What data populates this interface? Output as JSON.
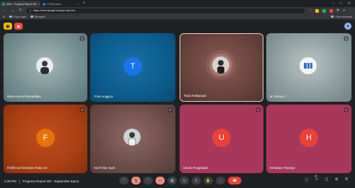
{
  "browser": {
    "tabs": [
      {
        "label": "Meet - Progress Report W2",
        "favicon_color": "#00ac47",
        "active": true
      },
      {
        "label": "IT DIR pame",
        "favicon_color": "#1a73e8",
        "active": false
      }
    ],
    "address": "https://meet.google.com/yjn-xrfp-hwo",
    "bookmarks": [
      {
        "label": "Pojok Ingin"
      },
      {
        "label": "Bimagam"
      }
    ],
    "other_bookmarks": "Other favorites"
  },
  "meet": {
    "participants": [
      {
        "name": "Reka Arminul Ramadhani",
        "type": "photo",
        "muted": true
      },
      {
        "name": "Trimo Anggoro",
        "type": "initial",
        "initial": "T",
        "avatar_color": "#1a73e8",
        "muted": false
      },
      {
        "name": "Firda Fathiaasari",
        "type": "photo",
        "muted": false,
        "speaking": true
      },
      {
        "name": "M. Wirnas A",
        "type": "photo",
        "muted": true
      },
      {
        "name": "Fireflies.ai Notetaker Raka Am",
        "type": "initial",
        "initial": "F",
        "avatar_color": "#e8710a",
        "muted": true
      },
      {
        "name": "Hanif Irfan Syah",
        "type": "photo",
        "muted": true
      },
      {
        "name": "Umam Pengadaan",
        "type": "initial",
        "initial": "U",
        "avatar_color": "#ea4335",
        "muted": true
      },
      {
        "name": "Hirnawan Prasetyo",
        "type": "initial",
        "initial": "H",
        "avatar_color": "#ea4335",
        "muted": true
      }
    ],
    "time": "4:38 PM",
    "meeting_title": "Progress Report W2 - September Eproc",
    "people_count": "8",
    "colors": {
      "tile_blue": "#0b5c8e",
      "tile_teal": "#5d7b7d",
      "tile_brown": "#6b463f",
      "tile_orange": "#a83f12",
      "tile_pink": "#a8375c",
      "end_call": "#ea4335",
      "mic_off": "#f28b82"
    }
  }
}
